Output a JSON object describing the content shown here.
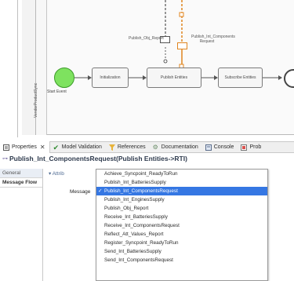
{
  "diagram": {
    "lane_label": "VendorProductSync",
    "start_event_label": "Start Event",
    "tasks": [
      "Initialization",
      "Publish Entities",
      "Subscribe Entities"
    ],
    "messages": [
      {
        "label": "Publish_Obj_Report"
      },
      {
        "label": "Publish_Int_Components Request"
      }
    ],
    "colors": {
      "start_fill": "#7ee25f",
      "selection": "#e0851f"
    }
  },
  "panel": {
    "tabs": [
      {
        "label": "Properties",
        "icon": "properties-icon",
        "active": true
      },
      {
        "label": "Model Validation",
        "icon": "checkmark-icon"
      },
      {
        "label": "References",
        "icon": "funnel-icon"
      },
      {
        "label": "Documentation",
        "icon": "gear-icon"
      },
      {
        "label": "Console",
        "icon": "console-icon"
      },
      {
        "label": "Prob",
        "icon": "problems-icon"
      }
    ],
    "title": "Publish_Int_ComponentsRequest(Publish Entities->RTI)",
    "side_tabs": [
      "General",
      "Message Flow"
    ],
    "section": "Attrib",
    "field_label": "Message",
    "options": [
      "Achieve_Syncpoint_ReadyToRun",
      "Publish_Int_BatteriesSupply",
      "Publish_Int_ComponentsRequest",
      "Publish_Int_EnginesSupply",
      "Publish_Obj_Report",
      "Receive_Int_BatteriesSupply",
      "Receive_Int_ComponentsRequest",
      "Reflect_Att_Values_Report",
      "Register_Syncpoint_ReadyToRun",
      "Send_Int_BatteriesSupply",
      "Send_Int_ComponentsRequest"
    ],
    "selected_option": "Publish_Int_ComponentsRequest"
  }
}
